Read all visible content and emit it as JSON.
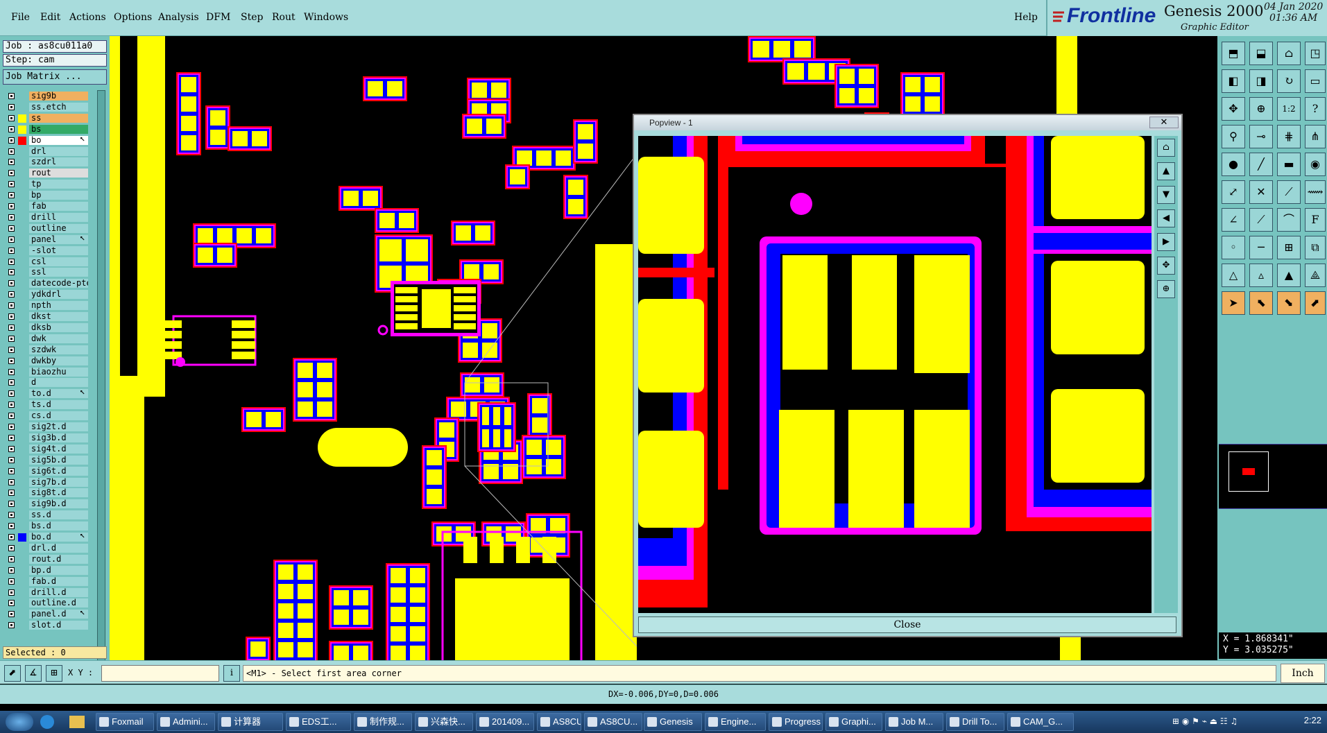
{
  "menu": {
    "items": [
      "File",
      "Edit",
      "Actions",
      "Options",
      "Analysis",
      "DFM",
      "Step",
      "Rout",
      "Windows"
    ],
    "help": "Help"
  },
  "brand": {
    "logo_text": "Frontline",
    "product": "Genesis 2000",
    "subtitle": "Graphic Editor",
    "date": "04 Jan 2020",
    "time": "01:36 AM"
  },
  "job": {
    "job_label": "Job : as8cu011a0",
    "step_label": "Step: cam",
    "matrix_button": "Job Matrix ..."
  },
  "layers": [
    {
      "name": "sig9b",
      "color": "#f0b060",
      "swatch": ""
    },
    {
      "name": "ss.etch",
      "color": "#9ad6d6",
      "swatch": ""
    },
    {
      "name": "ss",
      "color": "#f0b060",
      "swatch": "#ffff00"
    },
    {
      "name": "bs",
      "color": "#33aa66",
      "swatch": "#ffff00"
    },
    {
      "name": "bo",
      "color": "#ffffff",
      "swatch": "#ff0000",
      "arrow": "⭦"
    },
    {
      "name": "drl",
      "color": "#9ad6d6",
      "swatch": ""
    },
    {
      "name": "szdrl",
      "color": "#9ad6d6",
      "swatch": ""
    },
    {
      "name": "rout",
      "color": "#dddddd",
      "swatch": ""
    },
    {
      "name": "tp",
      "color": "#9ad6d6",
      "swatch": ""
    },
    {
      "name": "bp",
      "color": "#9ad6d6",
      "swatch": ""
    },
    {
      "name": "fab",
      "color": "#9ad6d6",
      "swatch": ""
    },
    {
      "name": "drill",
      "color": "#9ad6d6",
      "swatch": ""
    },
    {
      "name": "outline",
      "color": "#9ad6d6",
      "swatch": ""
    },
    {
      "name": "panel",
      "color": "#9ad6d6",
      "swatch": "",
      "arrow": "⭦"
    },
    {
      "name": "-slot",
      "color": "#9ad6d6",
      "swatch": ""
    },
    {
      "name": "csl",
      "color": "#9ad6d6",
      "swatch": ""
    },
    {
      "name": "ssl",
      "color": "#9ad6d6",
      "swatch": ""
    },
    {
      "name": "datecode-pte",
      "color": "#9ad6d6",
      "swatch": ""
    },
    {
      "name": "ydkdrl",
      "color": "#9ad6d6",
      "swatch": ""
    },
    {
      "name": "npth",
      "color": "#9ad6d6",
      "swatch": ""
    },
    {
      "name": "dkst",
      "color": "#9ad6d6",
      "swatch": ""
    },
    {
      "name": "dksb",
      "color": "#9ad6d6",
      "swatch": ""
    },
    {
      "name": "dwk",
      "color": "#9ad6d6",
      "swatch": ""
    },
    {
      "name": "szdwk",
      "color": "#9ad6d6",
      "swatch": ""
    },
    {
      "name": "dwkby",
      "color": "#9ad6d6",
      "swatch": ""
    },
    {
      "name": "biaozhu",
      "color": "#9ad6d6",
      "swatch": ""
    },
    {
      "name": "d",
      "color": "#9ad6d6",
      "swatch": ""
    },
    {
      "name": "to.d",
      "color": "#9ad6d6",
      "swatch": "",
      "arrow": "⭦"
    },
    {
      "name": "ts.d",
      "color": "#9ad6d6",
      "swatch": ""
    },
    {
      "name": "cs.d",
      "color": "#9ad6d6",
      "swatch": ""
    },
    {
      "name": "sig2t.d",
      "color": "#9ad6d6",
      "swatch": ""
    },
    {
      "name": "sig3b.d",
      "color": "#9ad6d6",
      "swatch": ""
    },
    {
      "name": "sig4t.d",
      "color": "#9ad6d6",
      "swatch": ""
    },
    {
      "name": "sig5b.d",
      "color": "#9ad6d6",
      "swatch": ""
    },
    {
      "name": "sig6t.d",
      "color": "#9ad6d6",
      "swatch": ""
    },
    {
      "name": "sig7b.d",
      "color": "#9ad6d6",
      "swatch": ""
    },
    {
      "name": "sig8t.d",
      "color": "#9ad6d6",
      "swatch": ""
    },
    {
      "name": "sig9b.d",
      "color": "#9ad6d6",
      "swatch": ""
    },
    {
      "name": "ss.d",
      "color": "#9ad6d6",
      "swatch": ""
    },
    {
      "name": "bs.d",
      "color": "#9ad6d6",
      "swatch": ""
    },
    {
      "name": "bo.d",
      "color": "#9ad6d6",
      "swatch": "#0000ff",
      "arrow": "⭦"
    },
    {
      "name": "drl.d",
      "color": "#9ad6d6",
      "swatch": ""
    },
    {
      "name": "rout.d",
      "color": "#9ad6d6",
      "swatch": ""
    },
    {
      "name": "bp.d",
      "color": "#9ad6d6",
      "swatch": ""
    },
    {
      "name": "fab.d",
      "color": "#9ad6d6",
      "swatch": ""
    },
    {
      "name": "drill.d",
      "color": "#9ad6d6",
      "swatch": ""
    },
    {
      "name": "outline.d",
      "color": "#9ad6d6",
      "swatch": ""
    },
    {
      "name": "panel.d",
      "color": "#9ad6d6",
      "swatch": "",
      "arrow": "⭦"
    },
    {
      "name": "slot.d",
      "color": "#9ad6d6",
      "swatch": ""
    }
  ],
  "selected_label": "Selected : 0",
  "popview": {
    "title": "Popview - 1",
    "close_x": "✕",
    "close_button": "Close"
  },
  "right_tools": {
    "ratio_label": "1:2"
  },
  "coords": {
    "x": "X = 1.868341\"",
    "y": "Y = 3.035275\""
  },
  "status": {
    "xy_label": "X Y :",
    "xy_value": "",
    "prompt": "<M1> - Select first area corner",
    "unit": "Inch",
    "delta": "DX=-0.006,DY=0,D=0.006"
  },
  "taskbar": {
    "items": [
      "Foxmail",
      "Admini...",
      "计算器",
      "EDS工...",
      "制作规...",
      "兴森快...",
      "201409...",
      "AS8CU...",
      "AS8CU...",
      "Genesis",
      "Engine...",
      "Progress",
      "Graphi...",
      "Job M...",
      "Drill To...",
      "CAM_G..."
    ],
    "clock": "2:22"
  },
  "colors": {
    "pad": "#ffff00",
    "mask": "#0000ff",
    "outline": "#ff00ff",
    "sm": "#ff0000",
    "panel": "#76c4bf"
  }
}
